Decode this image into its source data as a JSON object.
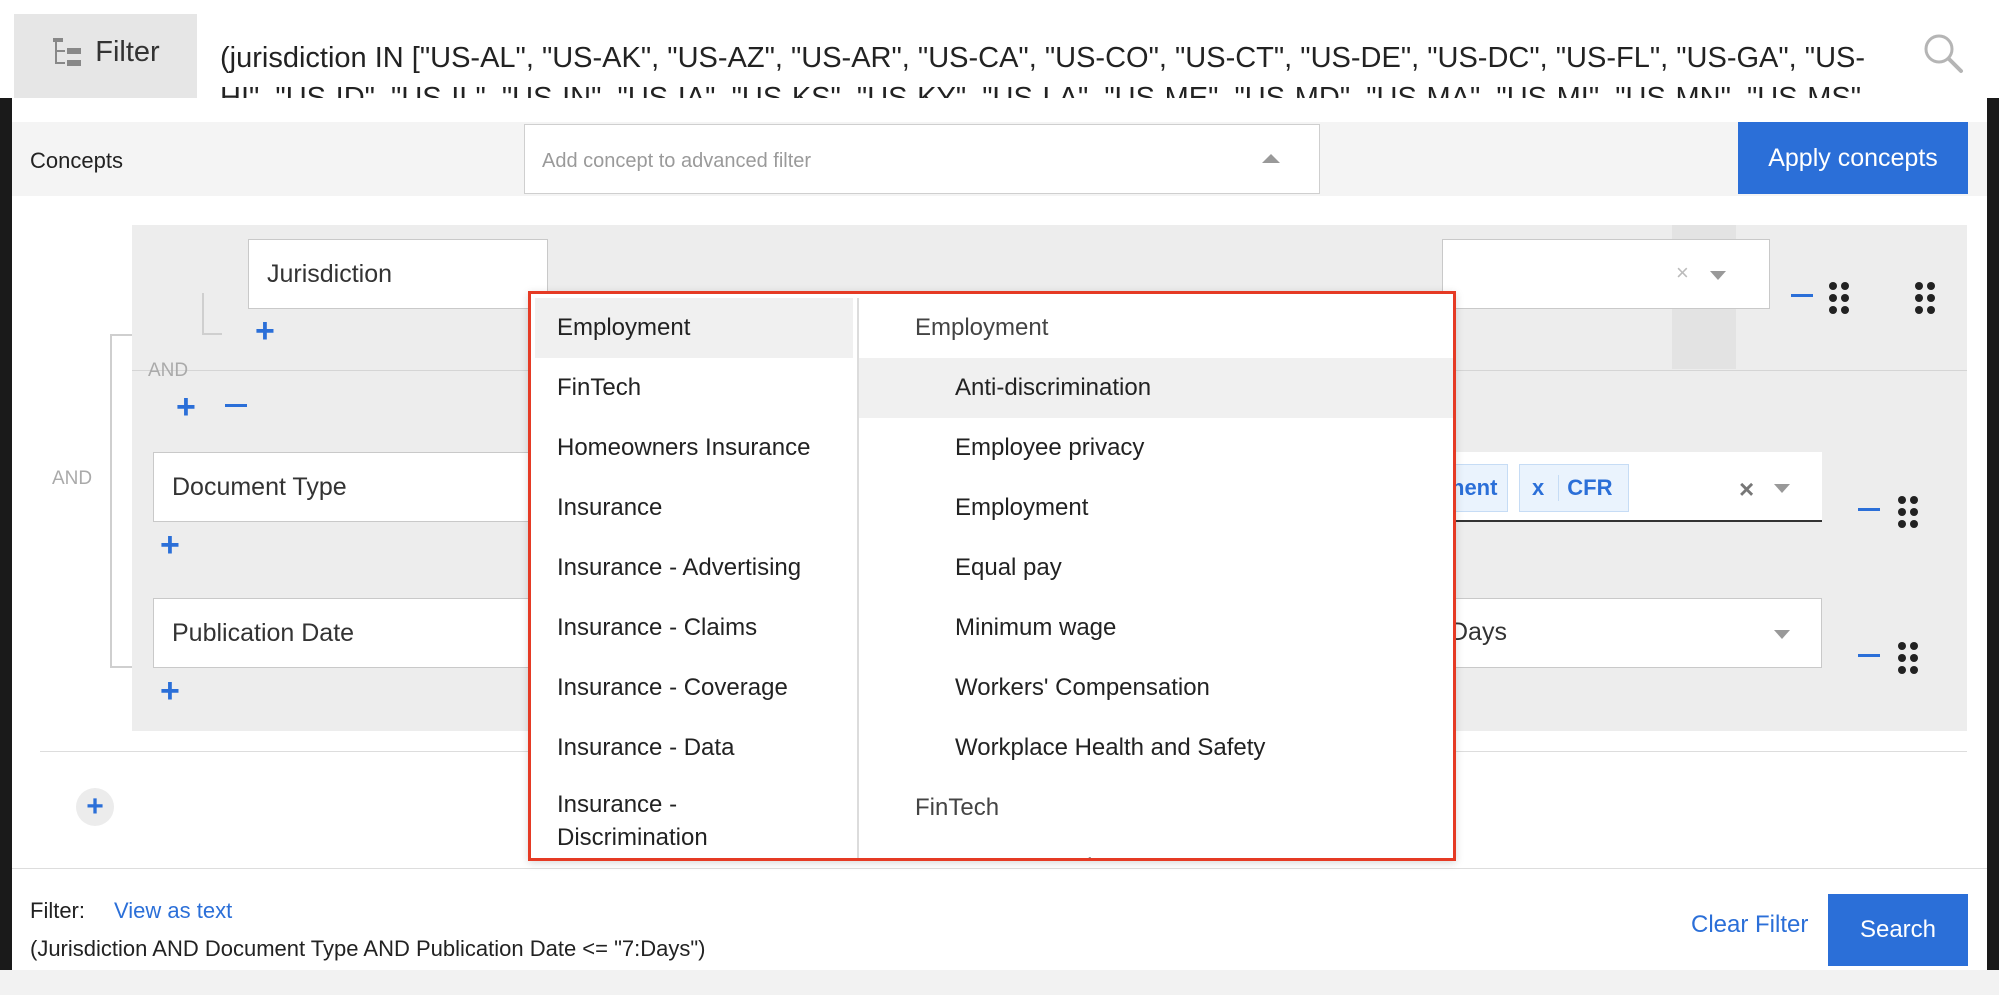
{
  "topbar": {
    "filter_label": "Filter",
    "query": "(jurisdiction IN [\"US-AL\", \"US-AK\", \"US-AZ\", \"US-AR\", \"US-CA\", \"US-CO\", \"US-CT\", \"US-DE\", \"US-DC\", \"US-FL\", \"US-GA\", \"US-HI\", \"US-ID\", \"US-IL\", \"US-IN\", \"US-IA\", \"US-KS\", \"US-KY\", \"US-LA\", \"US-ME\", \"US-MD\", \"US-MA\", \"US-MI\", \"US-MN\", \"US-MS\", \"US-MO\", \"US-MT\", \"US-"
  },
  "concepts": {
    "label": "Concepts",
    "placeholder": "Add concept to advanced filter",
    "apply_label": "Apply concepts"
  },
  "builder": {
    "operator_and_1": "AND",
    "operator_and_2": "AND",
    "rows": [
      {
        "field": "Jurisdiction"
      },
      {
        "field": "Document Type",
        "chips": [
          "nent",
          "CFR"
        ]
      },
      {
        "field": "Publication Date",
        "value": "Days"
      }
    ]
  },
  "dropdown": {
    "categories": [
      "Employment",
      "FinTech",
      "Homeowners Insurance",
      "Insurance",
      "Insurance - Advertising",
      "Insurance - Claims",
      "Insurance - Coverage",
      "Insurance - Data",
      "Insurance - Discrimination"
    ],
    "groups": [
      {
        "name": "Employment",
        "items": [
          "Anti-discrimination",
          "Employee privacy",
          "Employment",
          "Equal pay",
          "Minimum wage",
          "Workers' Compensation",
          "Workplace Health and Safety"
        ]
      },
      {
        "name": "FinTech",
        "items": [
          "Account Updates"
        ]
      }
    ]
  },
  "footer": {
    "filter_label": "Filter:",
    "view_as_text": "View as text",
    "expression": "(Jurisdiction AND Document Type AND Publication Date <= \"7:Days\")",
    "clear_label": "Clear Filter",
    "search_label": "Search"
  },
  "colors": {
    "accent": "#2b6fd8",
    "highlight_border": "#e53a24"
  },
  "icons": [
    "filter-tree-icon",
    "search-icon",
    "caret-up-icon",
    "caret-down-icon",
    "clear-icon",
    "drag-handle-icon",
    "plus-icon",
    "minus-icon"
  ]
}
